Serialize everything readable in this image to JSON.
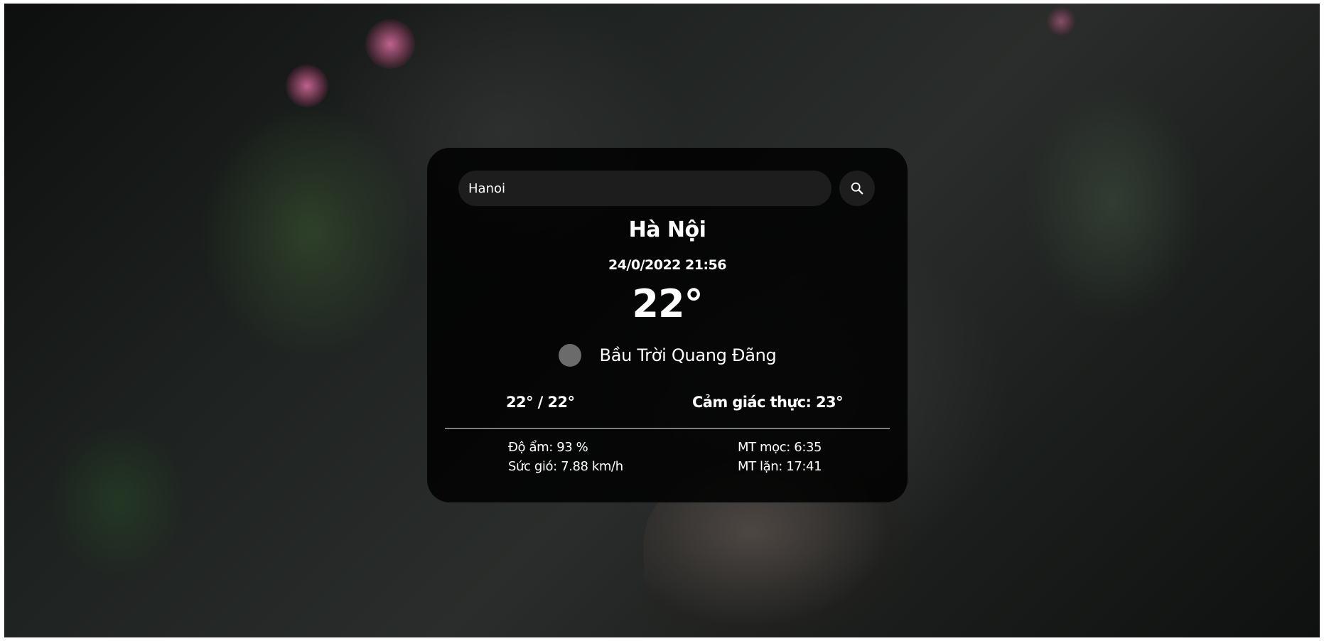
{
  "search": {
    "value": "Hanoi",
    "icon": "search-icon"
  },
  "weather": {
    "city": "Hà Nội",
    "datetime": "24/0/2022 21:56",
    "temperature": "22°",
    "condition": "Bầu Trời Quang Đãng",
    "condition_icon": "weather-condition-icon",
    "range": "22° / 22°",
    "feels_like": "Cảm giác thực: 23°"
  },
  "details": {
    "humidity": "Độ ẩm: 93 %",
    "wind": "Sức gió: 7.88 km/h",
    "sunrise": "MT mọc: 6:35",
    "sunset": "MT lặn: 17:41"
  }
}
